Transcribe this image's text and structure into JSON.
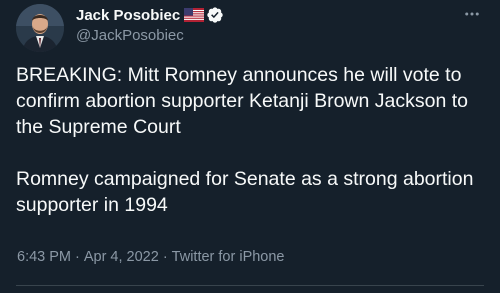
{
  "author": {
    "display_name": "Jack Posobiec",
    "handle": "@JackPosobiec",
    "flag_icon": "us-flag-icon",
    "verified_icon": "verified-badge-icon"
  },
  "tweet": {
    "paragraphs": [
      "BREAKING: Mitt Romney announces he will vote to confirm abortion supporter Ketanji Brown Jackson to the Supreme Court",
      "Romney campaigned for Senate as a strong abortion supporter in 1994"
    ],
    "time": "6:43 PM",
    "separator": "·",
    "date": "Apr 4, 2022",
    "source": "Twitter for iPhone"
  },
  "colors": {
    "background": "#15202b",
    "text": "#f7f9f9",
    "secondary_text": "#8b98a5",
    "verified": "#1d9bf0"
  }
}
